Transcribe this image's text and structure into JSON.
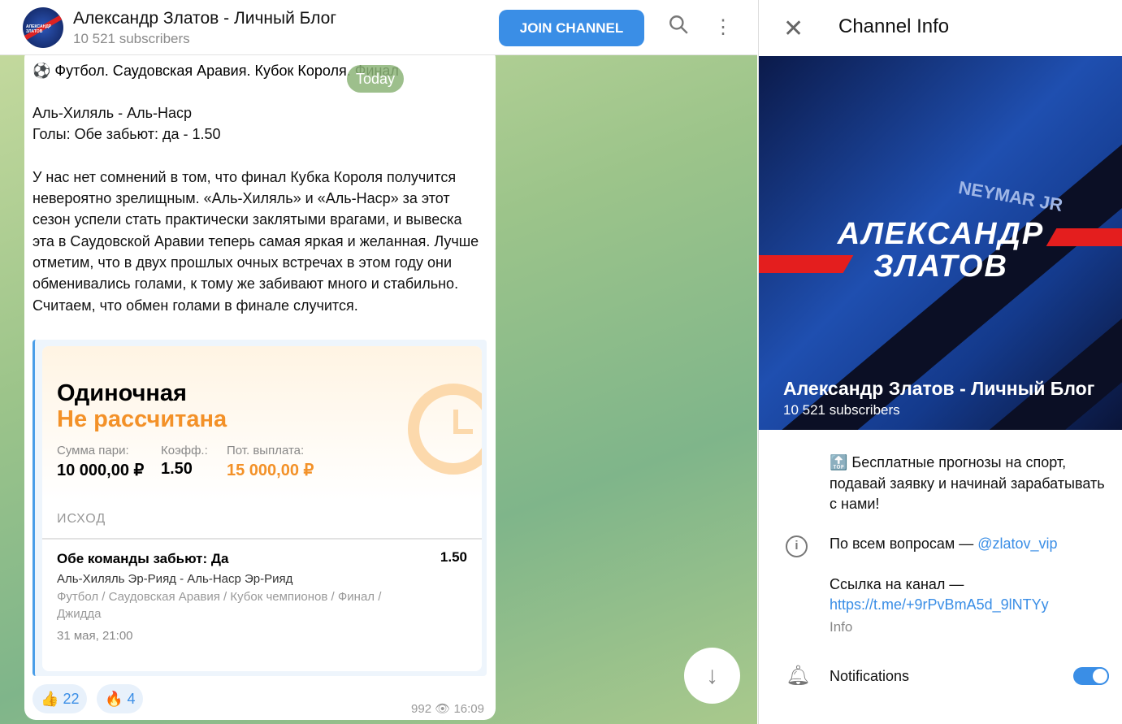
{
  "header": {
    "title": "Александр Златов - Личный Блог",
    "subscribers": "10 521 subscribers",
    "join_label": "JOIN CHANNEL",
    "avatar_text": "АЛЕКСАНДР ЗЛАТОВ"
  },
  "chat": {
    "date_badge": "Today",
    "message": {
      "title": "⚽ Футбол. Саудовская Аравия. Кубок Короля. Финал",
      "body": "Аль-Хиляль - Аль-Наср\nГолы: Обе забьют: да - 1.50\n\nУ нас нет сомнений в том, что финал Кубка Короля получится невероятно зрелищным. «Аль-Хиляль» и «Аль-Наср» за этот сезон успели стать практически заклятыми врагами, и вывеска эта в Саудовской Аравии теперь самая яркая и желанная. Лучше отметим, что в двух прошлых очных встречах в этом году они обменивались голами, к тому же забивают много и стабильно. Считаем, что обмен голами в финале случится.",
      "bet": {
        "type": "Одиночная",
        "status": "Не рассчитана",
        "stake_label": "Сумма пари:",
        "stake": "10 000,00 ₽",
        "odds_label": "Коэфф.:",
        "odds": "1.50",
        "payout_label": "Пот. выплата:",
        "payout": "15 000,00 ₽",
        "outcome_header": "ИСХОД",
        "selection": "Обе команды забьют: Да",
        "selection_odds": "1.50",
        "teams": "Аль-Хиляль Эр-Рияд - Аль-Наср Эр-Рияд",
        "path": "Футбол / Саудовская Аравия / Кубок чемпионов / Финал / Джидда",
        "date": "31 мая, 21:00"
      },
      "reactions": [
        {
          "emoji": "👍",
          "count": "22"
        },
        {
          "emoji": "🔥",
          "count": "4"
        }
      ],
      "views": "992",
      "time": "16:09"
    }
  },
  "panel": {
    "title": "Channel Info",
    "banner_logo_line1": "АЛЕКСАНДР",
    "banner_logo_line2": "ЗЛАТОВ",
    "banner_text": "NEYMAR JR",
    "name": "Александр Златов - Личный Блог",
    "subscribers": "10 521 subscribers",
    "description": "🔝 Бесплатные прогнозы на спорт, подавай заявку и начинай зарабатывать с нами!",
    "contact_text": "По всем вопросам — ",
    "contact_link": "@zlatov_vip",
    "link_text": "Ссылка на канал —",
    "link_url": "https://t.me/+9rPvBmA5d_9lNTYy",
    "info_label": "Info",
    "notifications_label": "Notifications",
    "notifications_on": true
  },
  "colors": {
    "accent": "#3a8ee6",
    "orange": "#f39128"
  }
}
